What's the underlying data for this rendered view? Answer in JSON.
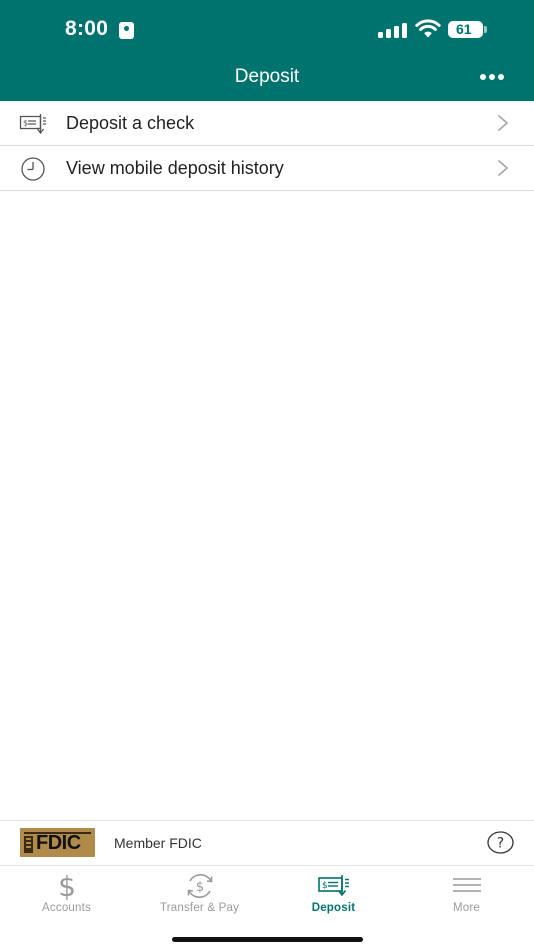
{
  "status_bar": {
    "time": "8:00",
    "battery": "61"
  },
  "header": {
    "title": "Deposit"
  },
  "menu": [
    {
      "label": "Deposit a check",
      "icon": "check-deposit-icon"
    },
    {
      "label": "View mobile deposit history",
      "icon": "clock-icon"
    }
  ],
  "footer": {
    "logo_text": "FDIC",
    "member_text": "Member FDIC"
  },
  "tabs": [
    {
      "label": "Accounts",
      "icon": "dollar-icon",
      "active": false
    },
    {
      "label": "Transfer & Pay",
      "icon": "transfer-icon",
      "active": false
    },
    {
      "label": "Deposit",
      "icon": "check-deposit-icon",
      "active": true
    },
    {
      "label": "More",
      "icon": "menu-lines-icon",
      "active": false
    }
  ],
  "colors": {
    "brand": "#00736f",
    "inactive_tab": "#9a9a9a",
    "fdic_gold": "#b08a4b"
  }
}
